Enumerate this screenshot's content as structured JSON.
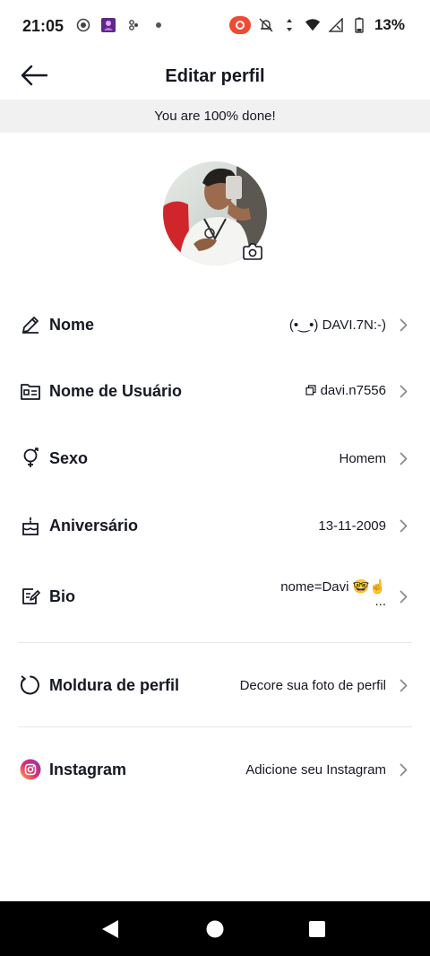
{
  "status_bar": {
    "time": "21:05",
    "battery": "13%",
    "icons_left": [
      "screen-record-icon",
      "app-notification-icon",
      "accessibility-icon",
      "dot-icon"
    ],
    "icons_right": [
      "recording-icon",
      "mute-icon",
      "data-icon",
      "wifi-icon",
      "signal-icon",
      "battery-icon"
    ]
  },
  "header": {
    "title": "Editar perfil",
    "back_icon": "arrow-left-icon"
  },
  "progress_banner": "You are 100% done!",
  "profile_rows": [
    {
      "label": "Nome",
      "value": "(•‿•)  DAVI.7N:-)",
      "icon": "pencil-icon"
    },
    {
      "label": "Nome de Usuário",
      "value": "davi.n7556",
      "icon": "id-card-icon",
      "value_icon": "copy-icon"
    },
    {
      "label": "Sexo",
      "value": "Homem",
      "icon": "gender-icon"
    },
    {
      "label": "Aniversário",
      "value": "13-11-2009",
      "icon": "cake-icon"
    },
    {
      "label": "Bio",
      "value": "nome=Davi 🤓☝️",
      "value_line2": "...",
      "icon": "bio-icon"
    },
    {
      "label": "Moldura de perfil",
      "value": "Decore sua foto de perfil",
      "icon": "frame-icon"
    },
    {
      "label": "Instagram",
      "value": "Adicione seu Instagram",
      "icon": "instagram-icon"
    }
  ],
  "colors": {
    "text": "#161823",
    "banner_bg": "#f1f1f2",
    "divider": "#e6e6e7",
    "chevron": "#8a8b91",
    "record": "#ef4a32"
  },
  "nav_bar": [
    "back-triangle-icon",
    "home-circle-icon",
    "recents-square-icon"
  ]
}
